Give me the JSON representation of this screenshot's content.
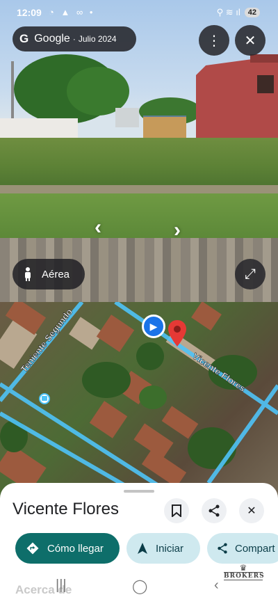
{
  "status_bar": {
    "time": "12:09",
    "left_icons": "◔ ▲ ∞ •",
    "right_icons": "⚲ ≋ ıl",
    "battery": "42"
  },
  "street_view": {
    "brand_letter": "G",
    "brand": "Google",
    "dot": "·",
    "capture_date": "Julio 2024",
    "menu_icon": "⋮",
    "close_icon": "✕",
    "prev_arrow": "‹",
    "next_arrow": "›",
    "aerea_label": "Aérea",
    "expand_icon": "⤢"
  },
  "map": {
    "streets": [
      "Teniente Segundo",
      "Vicente Flores"
    ],
    "play_icon": "▶"
  },
  "sheet": {
    "title": "Vicente Flores",
    "save_icon": "🔖",
    "share_icon": "⤴",
    "close_icon": "✕",
    "actions": [
      {
        "icon": "◆",
        "label": "Cómo llegar"
      },
      {
        "icon": "▲",
        "label": "Iniciar"
      },
      {
        "icon": "⤴",
        "label": "Compart"
      }
    ],
    "about_label": "Acerca de"
  },
  "navbar": {
    "recent": "|||",
    "home": "◯",
    "back": "‹"
  },
  "watermark": {
    "crown": "♛",
    "text": "BROKERS"
  },
  "colors": {
    "primary_button": "#0e6e6a",
    "secondary_button": "#cfe9ef",
    "map_street": "#4fc3f7",
    "pin": "#e53935",
    "play": "#1a73e8"
  }
}
